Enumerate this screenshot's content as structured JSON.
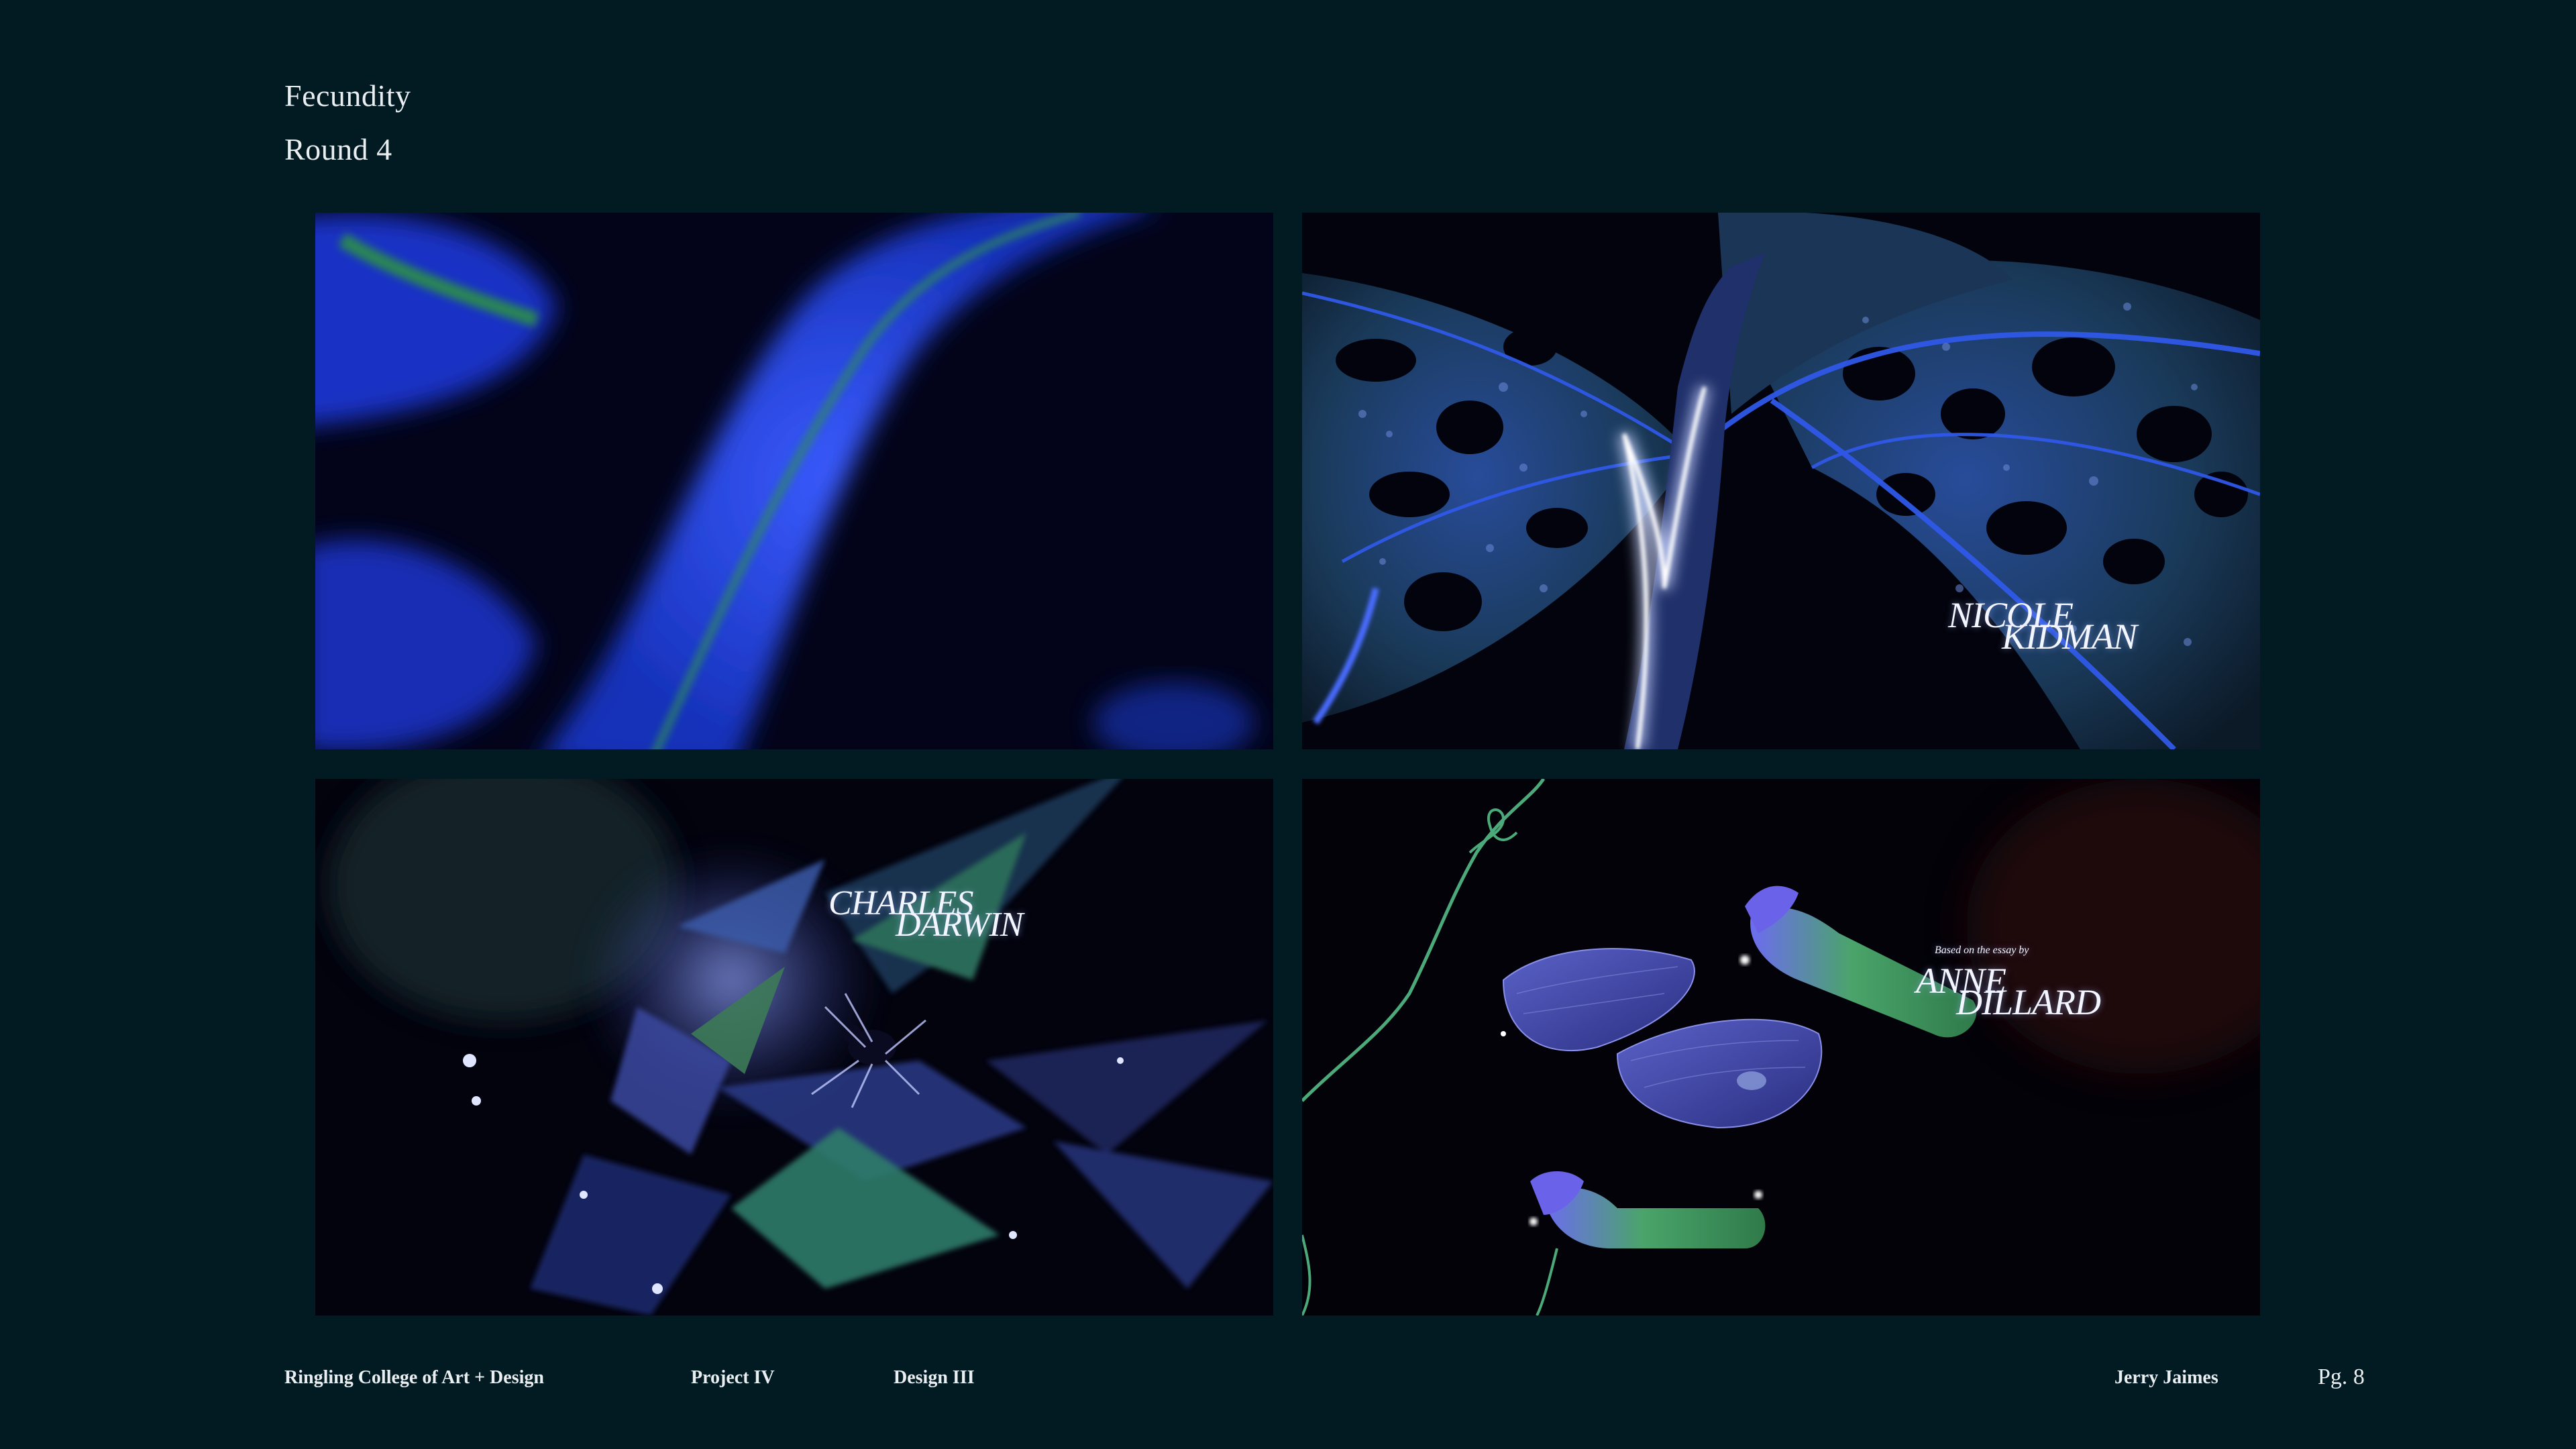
{
  "header": {
    "title": "Fecundity",
    "subtitle": "Round 4"
  },
  "frames": [
    {
      "name": "frame-1",
      "description_colors": {
        "primary": "#1f3fe0",
        "accent": "#2f8a3c"
      },
      "credit": null
    },
    {
      "name": "frame-2",
      "credit": {
        "line1": "NICOLE",
        "line2": "KIDMAN"
      }
    },
    {
      "name": "frame-3",
      "credit": {
        "line1": "CHARLES",
        "line2": "DARWIN"
      }
    },
    {
      "name": "frame-4",
      "credit": {
        "pre": "Based on the essay by",
        "line1": "ANNE",
        "line2": "DILLARD"
      }
    }
  ],
  "footer": {
    "college": "Ringling College of Art + Design",
    "project": "Project IV",
    "design": "Design III",
    "author": "Jerry Jaimes",
    "page": "Pg. 8"
  },
  "colors": {
    "background": "#021a22",
    "text": "#e9eef0",
    "blue_accent": "#2c4cff"
  }
}
